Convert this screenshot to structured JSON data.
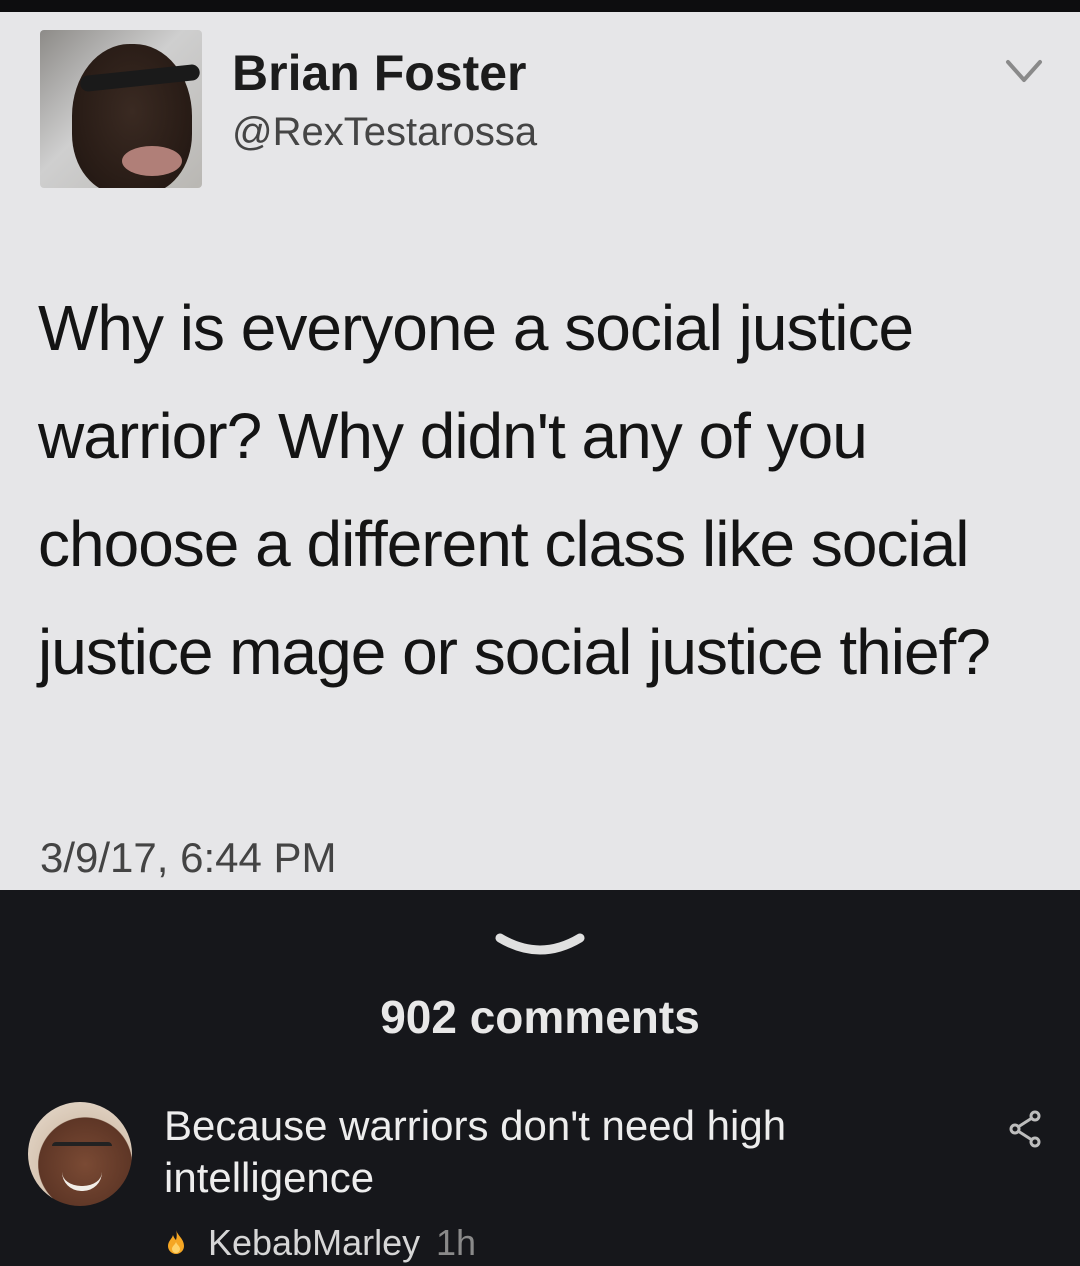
{
  "tweet": {
    "author_name": "Brian Foster",
    "author_handle": "@RexTestarossa",
    "text": "Why is everyone a social justice warrior? Why didn't any of you choose a different class like social justice mage or social justice thief?",
    "timestamp": "3/9/17, 6:44 PM",
    "menu_icon": "chevron-down-icon"
  },
  "thread": {
    "collapse_icon": "chevron-down-icon",
    "comments_label": "902 comments"
  },
  "comment": {
    "text": "Because warriors don't need high intelligence",
    "user": "KebabMarley",
    "age": "1h",
    "user_badge_icon": "flame-icon",
    "badge_color": "#f5a623",
    "share_icon": "share-icon"
  }
}
